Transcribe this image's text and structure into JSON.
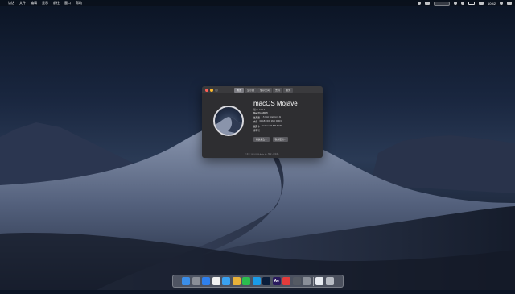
{
  "menubar": {
    "apple_symbol": "",
    "items": [
      "访达",
      "文件",
      "编辑",
      "显示",
      "前往",
      "窗口",
      "帮助"
    ],
    "clock": "10:42"
  },
  "about_window": {
    "tabs": [
      "概览",
      "显示器",
      "储存空间",
      "支持",
      "服务"
    ],
    "active_tab": 0,
    "os_name": "macOS Mojave",
    "os_version": "版本 10.14",
    "specs": [
      {
        "key": "Mac Pro (2017)",
        "value": ""
      },
      {
        "key": "处理器",
        "value": "3.5 GHz Intel Core i9"
      },
      {
        "key": "内存",
        "value": "32 GB 2400 MHz DDR4"
      },
      {
        "key": "图形卡",
        "value": "Radeon RX 580 8 GB"
      },
      {
        "key": "序列号",
        "value": ""
      }
    ],
    "buttons": [
      "系统报告...",
      "软件更新..."
    ],
    "footer": "™ 和 © 1983-2018 Apple Inc. 保留一切权利。"
  },
  "dock": {
    "items": [
      {
        "name": "finder-icon",
        "color": "#3b8ee8",
        "glyph": ""
      },
      {
        "name": "launchpad-icon",
        "color": "#8a8f98",
        "glyph": ""
      },
      {
        "name": "app-store-icon",
        "color": "#2f80ed",
        "glyph": ""
      },
      {
        "name": "calendar-icon",
        "color": "#f2f2f2",
        "glyph": ""
      },
      {
        "name": "safari-icon",
        "color": "#3aa1f0",
        "glyph": ""
      },
      {
        "name": "chrome-icon",
        "color": "#e9b23a",
        "glyph": ""
      },
      {
        "name": "wechat-icon",
        "color": "#2cbc4f",
        "glyph": ""
      },
      {
        "name": "qq-icon",
        "color": "#1b9be8",
        "glyph": ""
      },
      {
        "name": "photoshop-icon",
        "color": "#0b1d3a",
        "glyph": ""
      },
      {
        "name": "after-effects-icon",
        "color": "#2a1a5e",
        "glyph": "Ae"
      },
      {
        "name": "netease-music-icon",
        "color": "#e33b3b",
        "glyph": ""
      },
      {
        "name": "photo-booth-icon",
        "color": "#555a63",
        "glyph": ""
      },
      {
        "name": "system-preferences-icon",
        "color": "#8a8f98",
        "glyph": ""
      },
      {
        "name": "document-icon",
        "color": "#e8ecf2",
        "glyph": ""
      },
      {
        "name": "trash-icon",
        "color": "#b8bcc4",
        "glyph": ""
      }
    ]
  }
}
